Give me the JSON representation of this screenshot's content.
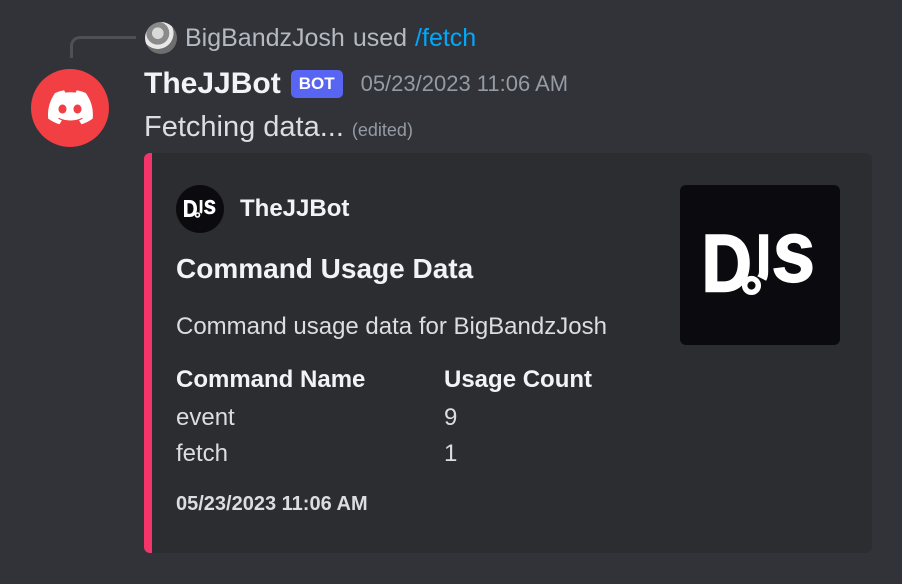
{
  "reply": {
    "username": "BigBandzJosh",
    "used_text": "used",
    "command": "/fetch"
  },
  "message": {
    "author": "TheJJBot",
    "badge": "BOT",
    "timestamp": "05/23/2023 11:06 AM",
    "content": "Fetching data...",
    "edited": "(edited)"
  },
  "embed": {
    "color": "#f5346a",
    "author_name": "TheJJBot",
    "title": "Command Usage Data",
    "description": "Command usage data for BigBandzJosh",
    "fields": [
      {
        "name": "Command Name",
        "values": [
          "event",
          "fetch"
        ]
      },
      {
        "name": "Usage Count",
        "values": [
          "9",
          "1"
        ]
      }
    ],
    "footer": "05/23/2023 11:06 AM",
    "author_icon": "djs-logo-icon",
    "thumbnail_icon": "djs-logo-icon"
  },
  "colors": {
    "background": "#313338",
    "embed_background": "#2b2d31",
    "avatar": "#f23f43",
    "bot_badge": "#5865f2",
    "command_link": "#00a8fc"
  }
}
